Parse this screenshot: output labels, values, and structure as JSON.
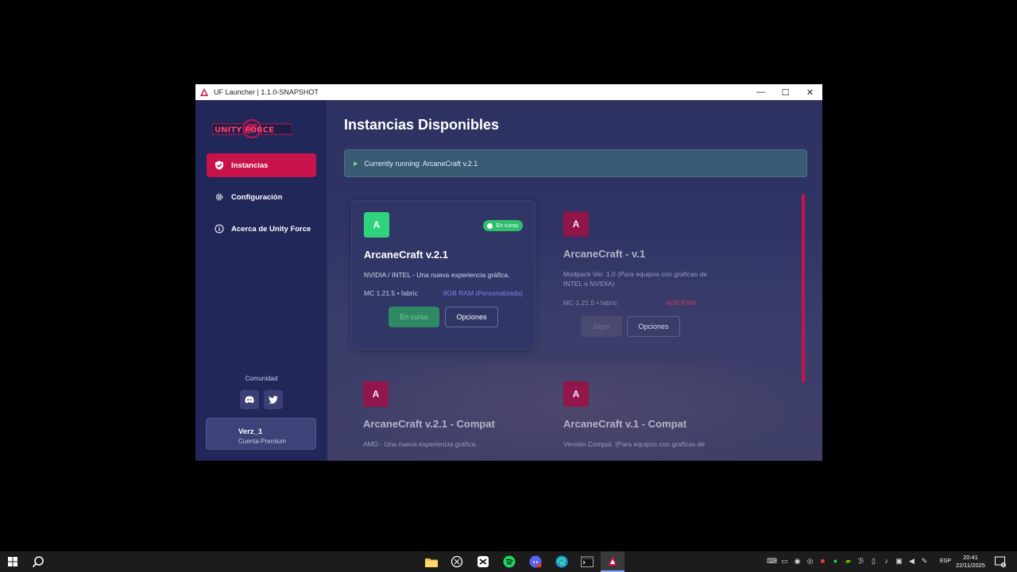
{
  "window": {
    "title": "UF Launcher | 1.1.0-SNAPSHOT",
    "controls": {
      "minimize": "—",
      "maximize": "☐",
      "close": "✕"
    }
  },
  "sidebar": {
    "logo_text": "UNITY FORCE",
    "items": [
      {
        "label": "Instancias",
        "icon": "shield-check-icon",
        "active": true
      },
      {
        "label": "Configuración",
        "icon": "gear-icon",
        "active": false
      },
      {
        "label": "Acerca de Unity Force",
        "icon": "info-icon",
        "active": false
      }
    ],
    "community_label": "Comunidad",
    "socials": [
      "discord-icon",
      "twitter-icon"
    ],
    "user": {
      "name": "Verz_1",
      "type": "Cuenta Premium"
    }
  },
  "main": {
    "title": "Instancias Disponibles",
    "running_text": "Currently running: ArcaneCraft v.2.1",
    "cards": [
      {
        "initial": "A",
        "name": "ArcaneCraft v.2.1",
        "badge": "En curso",
        "description": "NVIDIA / INTEL - Una nueva experiencia gráfica.",
        "meta": "MC 1.21.5 • fabric",
        "ram": "8GB RAM (Personalizada)",
        "primary_button": "En curso",
        "options_button": "Opciones"
      },
      {
        "initial": "A",
        "name": "ArcaneCraft - v.1",
        "description": "Modpack Ver. 1.0 (Para equipos con graficas de INTEL o NVIDIA)",
        "meta": "MC 1.21.5 • fabric",
        "ram": "4GB RAM",
        "primary_button": "Jugar",
        "options_button": "Opciones"
      },
      {
        "initial": "A",
        "name": "ArcaneCraft v.2.1 - Compat",
        "description": "AMD - Una nueva experiencia gráfica."
      },
      {
        "initial": "A",
        "name": "ArcaneCraft v.1 - Compat",
        "description": "Versión Compat. (Para equipos con graficas de"
      }
    ]
  },
  "colors": {
    "accent": "#c8124a",
    "running_green": "#2fd37d",
    "sidebar_bg": "#22275a",
    "main_bg": "#2d3261"
  },
  "taskbar": {
    "language": "ESP",
    "time": "20:41",
    "date": "22/11/2025",
    "notification_count": "8"
  }
}
